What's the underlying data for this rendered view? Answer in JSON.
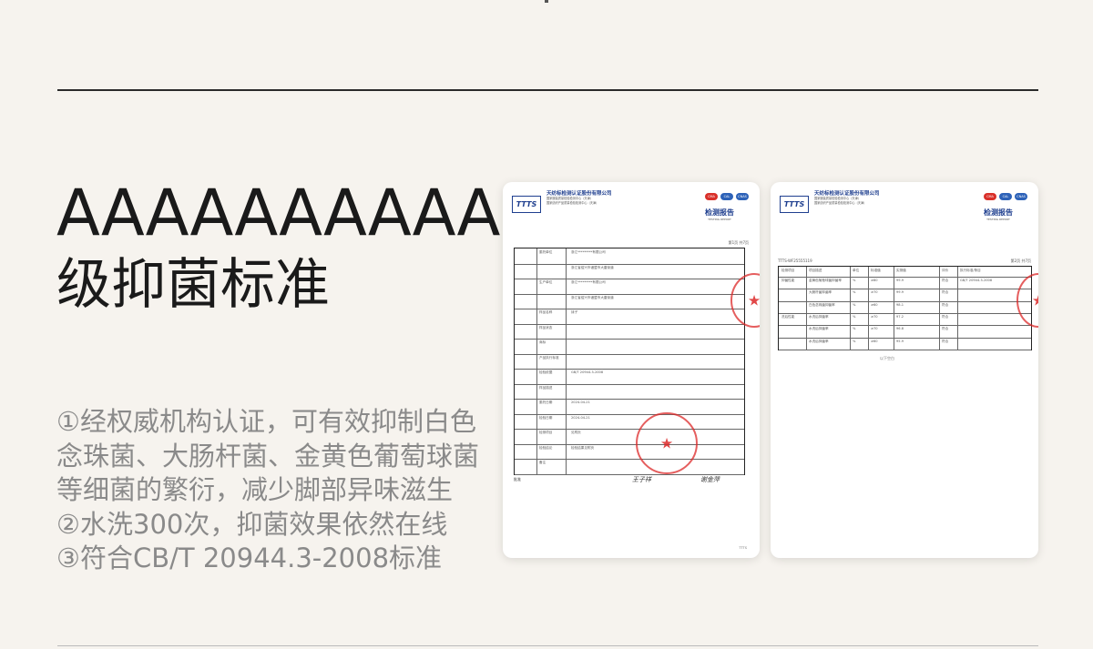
{
  "headline": {
    "line1": "AAAAAAAAAA",
    "line2": "级抑菌标准"
  },
  "features": [
    "①经权威机构认证，可有效抑制白色",
    "念珠菌、大肠杆菌、金黄色葡萄球菌",
    "等细菌的繁衍，减少脚部异味滋生",
    "②水洗300次，抑菌效果依然在线",
    "③符合CB/T 20944.3-2008标准"
  ],
  "report1": {
    "logo": "TTTS",
    "org_name": "天纺标检测认证股份有限公司",
    "org_sub1": "国家服装质量检验检测中心（天津）",
    "org_sub2": "国家纺织产品质量检验检测中心（天津）",
    "cert_ma": "CMA",
    "cert_cal": "CAL",
    "cert_cnas": "CNAS",
    "title": "检测报告",
    "title_en": "TESTING REPORT",
    "page": "第1页 共7页",
    "rows": [
      {
        "label": "委托单位",
        "value": "浙江*********有限公司"
      },
      {
        "label": "",
        "value": "浙江省绍兴市诸暨市大唐街道"
      },
      {
        "label": "生产单位",
        "value": "浙江*********有限公司"
      },
      {
        "label": "",
        "value": "浙江省绍兴市诸暨市大唐街道"
      },
      {
        "label": "样品名称",
        "value": "袜子"
      },
      {
        "label": "样品状态",
        "value": ""
      },
      {
        "label": "商标",
        "value": ""
      },
      {
        "label": "产品执行标准",
        "value": ""
      },
      {
        "label": "检验依据",
        "value": "GB/T 20944.3-2008"
      },
      {
        "label": "样品描述",
        "value": ""
      },
      {
        "label": "委托日期",
        "value": "2024-04-21"
      },
      {
        "label": "检验日期",
        "value": "2024-04-21"
      },
      {
        "label": "检测项目",
        "value": "见附页"
      },
      {
        "label": "检验结论",
        "value": "检验结果见附页"
      },
      {
        "label": "备注",
        "value": ""
      }
    ],
    "signature_labels": {
      "approve": "批准",
      "review": "审核",
      "test": "检验"
    },
    "signatures": [
      "王子祥",
      "谢金萍"
    ],
    "stamp_text": "检测报告专用章"
  },
  "report2": {
    "logo": "TTTS",
    "org_name": "天纺标检测认证股份有限公司",
    "org_sub1": "国家服装质量检验检测中心（天津）",
    "org_sub2": "国家纺织产品质量检验检测中心（天津）",
    "cert_ma": "CMA",
    "cert_cal": "CAL",
    "cert_cnas": "CNAS",
    "title": "检测报告",
    "title_en": "TESTING REPORT",
    "report_no": "TTTS-WF25555119",
    "page": "第2页 共7页",
    "header_cols": [
      "检测项目",
      "项目描述",
      "单位",
      "标准值",
      "实测值",
      "评价",
      "执行标准/条目"
    ],
    "rows": [
      {
        "item": "抑菌性能",
        "desc": "金黄色葡萄球菌抑菌率",
        "unit": "%",
        "std": "≥80",
        "val": "99.9",
        "eval": "符合"
      },
      {
        "item": "",
        "desc": "大肠杆菌抑菌率",
        "unit": "%",
        "std": "≥70",
        "val": "99.9",
        "eval": "符合"
      },
      {
        "item": "",
        "desc": "白色念珠菌抑菌率",
        "unit": "%",
        "std": "≥60",
        "val": "98.1",
        "eval": "符合"
      },
      {
        "item": "洗后性能",
        "desc": "水洗后抑菌率",
        "unit": "%",
        "std": "≥70",
        "val": "97.2",
        "eval": "符合"
      },
      {
        "item": "",
        "desc": "水洗后抑菌率",
        "unit": "%",
        "std": "≥70",
        "val": "96.8",
        "eval": "符合"
      },
      {
        "item": "",
        "desc": "水洗后抑菌率",
        "unit": "%",
        "std": "≥60",
        "val": "95.9",
        "eval": "符合"
      }
    ],
    "standard_ref": "GB/T 20944.3-2008",
    "end_note": "以下空白"
  }
}
